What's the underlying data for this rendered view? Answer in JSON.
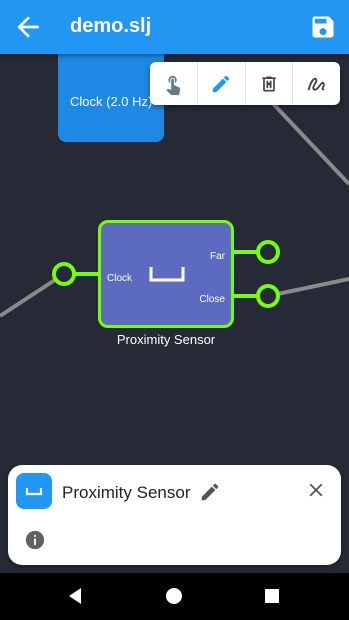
{
  "appbar": {
    "title": "demo.slj",
    "back_icon": "arrow-back-icon",
    "save_icon": "save-icon"
  },
  "canvas": {
    "clock_node": {
      "label": "Clock (2.0 Hz)"
    },
    "toolbar": {
      "icons": [
        "touch-icon",
        "pencil-icon",
        "delete-icon",
        "wire-icon"
      ]
    },
    "sensor_node": {
      "name": "Proximity Sensor",
      "ports": {
        "input": "Clock",
        "output_far": "Far",
        "output_close": "Close"
      }
    }
  },
  "panel": {
    "title": "Proximity Sensor",
    "icons": [
      "sensor-icon",
      "edit-icon",
      "close-icon",
      "info-icon"
    ]
  },
  "navbar": {
    "buttons": [
      "back",
      "home",
      "recents"
    ]
  },
  "colors": {
    "appbar": "#2196f3",
    "canvas": "#262a37",
    "node_fill": "#5c6bc0",
    "node_border": "#76ff03",
    "wire": "#8a8a8a"
  }
}
